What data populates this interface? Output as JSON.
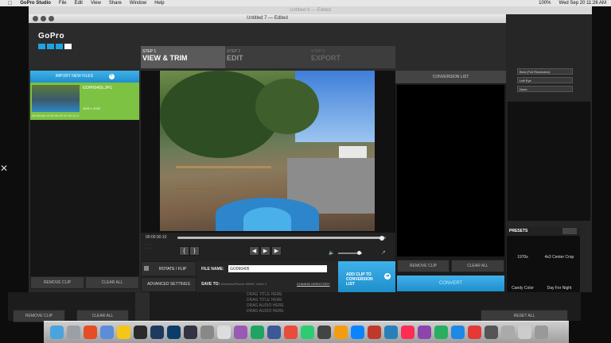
{
  "menubar": {
    "app_name": "GoPro Studio",
    "items": [
      "File",
      "Edit",
      "View",
      "Share",
      "Window",
      "Help"
    ],
    "status_text": "100%",
    "datetime": "Wed Sep 20  11:26 AM"
  },
  "background_window": {
    "title": "Untitled 6 — Edited"
  },
  "window": {
    "title": "Untitled 7 — Edited"
  },
  "logo": {
    "text": "GoPro"
  },
  "steps": [
    {
      "number": "STEP 1",
      "label": "VIEW & TRIM",
      "active": true
    },
    {
      "number": "STEP 2",
      "label": "EDIT",
      "active": false
    },
    {
      "number": "STEP 3",
      "label": "EXPORT",
      "active": false
    }
  ],
  "import": {
    "label": "IMPORT NEW FILES"
  },
  "clip": {
    "name": "GOPR0405.JPG",
    "resolution": "4000 x 3000",
    "meta": "05.00 AM   11:00   06.00.21.00   21:3"
  },
  "left_buttons": {
    "remove_clip": "REMOVE CLIP",
    "clear_all": "CLEAR ALL"
  },
  "player": {
    "timecode": "00:00:30:10",
    "progress": 0.98
  },
  "bottom": {
    "rotate_flip": "ROTATE / FLIP",
    "advanced_settings": "ADVANCED SETTINGS",
    "file_name_label": "FILE NAME:",
    "file_name_value": "GO090405",
    "save_to_label": "SAVE TO:",
    "save_to_path": "/Volumes/iPhone-SBN2/_Work 3",
    "change_directory": "CHANGE DIRECTORY",
    "add_clip": "ADD CLIP TO CONVERSION LIST"
  },
  "conversion": {
    "header": "CONVERSION LIST",
    "remove_clip": "REMOVE CLIP",
    "clear_all": "CLEAR ALL",
    "convert": "CONVERT"
  },
  "right_panel": {
    "dropdowns": [
      "Best (Full Resolution)",
      "Left Eye",
      "None"
    ],
    "presets_label": "PRESETS",
    "presets": [
      "1970s",
      "4x3 Center Crop",
      "Candy Color",
      "Day For Night"
    ],
    "reset_all": "RESET ALL"
  },
  "timeline": {
    "rows": [
      "DRAG TITLE HERE",
      "DRAG TITLE HERE",
      "DRAG AUDIO HERE",
      "DRAG AUDIO HERE"
    ],
    "remove_clip": "REMOVE CLIP",
    "clear_all": "CLEAR ALL"
  },
  "dock": {
    "colors": [
      "#4aa3df",
      "#9aa0a6",
      "#e44d26",
      "#5b8dd9",
      "#f5c518",
      "#2a2a2a",
      "#1f3a5f",
      "#0b3d6b",
      "#334",
      "#888",
      "#ddd",
      "#9b59b6",
      "#1fa463",
      "#3b5998",
      "#e74c3c",
      "#2ecc71",
      "#444",
      "#f39c12",
      "#0a84ff",
      "#c0392b",
      "#2980b9",
      "#ff2d55",
      "#8e44ad",
      "#27ae60",
      "#1e88e5",
      "#e53935",
      "#555",
      "#aaa",
      "#ccc",
      "#999"
    ]
  }
}
